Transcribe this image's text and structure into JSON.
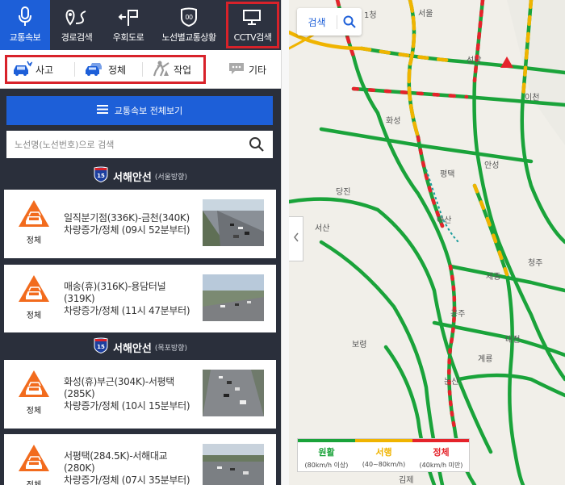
{
  "colors": {
    "accent": "#1d5fd8",
    "highlight": "#d8222a",
    "smooth": "#1aa33a",
    "slow": "#f0b400",
    "congested": "#e5232b"
  },
  "nav": {
    "tabs": [
      {
        "label": "교통속보",
        "icon": "microphone-icon",
        "active": true
      },
      {
        "label": "경로검색",
        "icon": "route-pin-icon"
      },
      {
        "label": "우회도로",
        "icon": "detour-icon"
      },
      {
        "label": "노선별교통상황",
        "icon": "highway-shield-icon"
      },
      {
        "label": "CCTV검색",
        "icon": "cctv-icon"
      }
    ]
  },
  "categories": [
    {
      "label": "사고",
      "icon": "accident-car-icon"
    },
    {
      "label": "정체",
      "icon": "congestion-car-icon"
    },
    {
      "label": "작업",
      "icon": "roadwork-icon"
    },
    {
      "label": "기타",
      "icon": "speech-bubble-icon"
    }
  ],
  "view_all_label": "교통속보 전체보기",
  "search": {
    "placeholder": "노선명(노선번호)으로 검색"
  },
  "routes": [
    {
      "number": "15",
      "name": "서해안선",
      "direction": "(서울방향)",
      "items": [
        {
          "state": "정체",
          "line1": "일직분기점(336K)-금천(340K)",
          "line2": "차량증가/정체 (09시 52분부터)"
        },
        {
          "state": "정체",
          "line1": "매송(휴)(316K)-용담터널",
          "line1b": "(319K)",
          "line2": "차량증가/정체 (11시 47분부터)"
        }
      ]
    },
    {
      "number": "15",
      "name": "서해안선",
      "direction": "(목포방향)",
      "items": [
        {
          "state": "정체",
          "line1": "화성(휴)부근(304K)-서평택",
          "line1b": "(285K)",
          "line2": "차량증가/정체 (10시 15분부터)"
        },
        {
          "state": "정체",
          "line1": "서평택(284.5K)-서해대교",
          "line1b": "(280K)",
          "line2": "차량증가/정체 (07시 35분부터)"
        }
      ]
    }
  ],
  "map": {
    "search_label": "검색",
    "places": [
      "서울",
      "1청",
      "성남",
      "이천",
      "안성",
      "평택",
      "당진",
      "서산",
      "아산",
      "세종",
      "청주",
      "공주",
      "대전",
      "보령",
      "계룡",
      "논산",
      "김제",
      "양",
      "화성",
      "안",
      "천",
      "원"
    ],
    "legend": [
      {
        "label": "원활",
        "range": "(80km/h 이상)",
        "color": "#1aa33a"
      },
      {
        "label": "서행",
        "range": "(40~80km/h)",
        "color": "#f0b400"
      },
      {
        "label": "정체",
        "range": "(40km/h 미만)",
        "color": "#e5232b"
      }
    ]
  }
}
